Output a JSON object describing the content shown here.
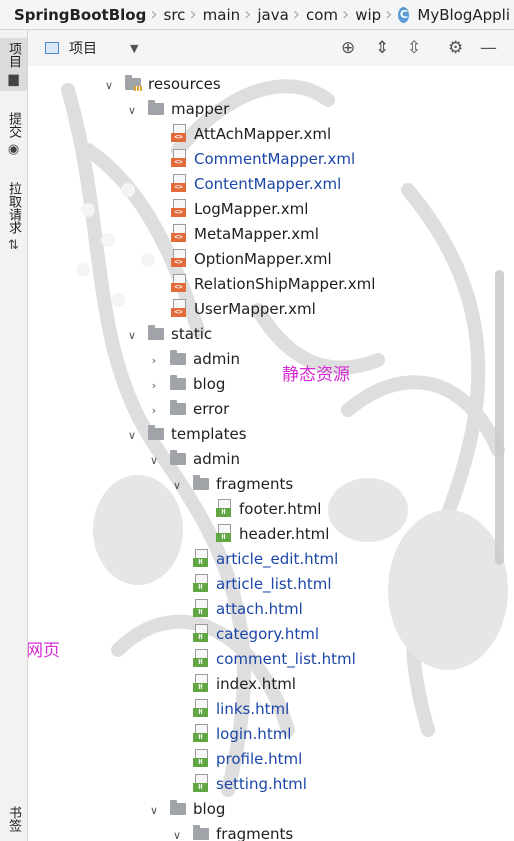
{
  "breadcrumb": [
    "SpringBootBlog",
    "src",
    "main",
    "java",
    "com",
    "wip",
    "MyBlogAppli"
  ],
  "left_strip": {
    "project_label": "项目",
    "commit_label": "提交",
    "pull_label": "拉取请求",
    "bookmarks_label": "书签"
  },
  "toolbar": {
    "view_label": "项目"
  },
  "tree": {
    "resources": "resources",
    "mapper": "mapper",
    "mapper_files": [
      "AttAchMapper.xml",
      "CommentMapper.xml",
      "ContentMapper.xml",
      "LogMapper.xml",
      "MetaMapper.xml",
      "OptionMapper.xml",
      "RelationShipMapper.xml",
      "UserMapper.xml"
    ],
    "static": "static",
    "static_children": [
      "admin",
      "blog",
      "error"
    ],
    "templates": "templates",
    "admin": "admin",
    "fragments": "fragments",
    "fragment_files": [
      "footer.html",
      "header.html"
    ],
    "admin_files": [
      "article_edit.html",
      "article_list.html",
      "attach.html",
      "category.html",
      "comment_list.html",
      "index.html",
      "links.html",
      "login.html",
      "profile.html",
      "setting.html"
    ],
    "blog": "blog",
    "blog_fragments": "fragments"
  },
  "annotations": {
    "static_note": "静态资源",
    "web_note": "网页"
  },
  "colors": {
    "modified": "#1b46a6",
    "annotation": "#d62bd6"
  }
}
